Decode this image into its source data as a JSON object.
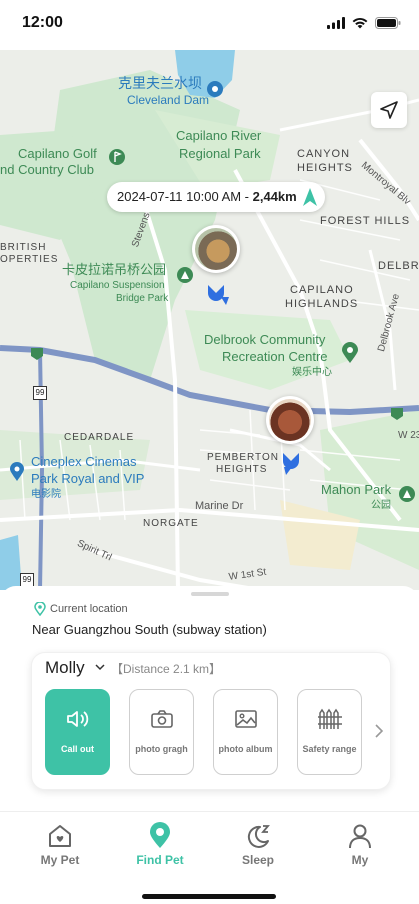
{
  "status_bar": {
    "time": "12:00"
  },
  "map": {
    "labels": {
      "cleveland_cn": "克里夫兰水坝",
      "cleveland_en": "Cleveland Dam",
      "capilano_river": "Capilano River",
      "regional_park": "Regional Park",
      "golf_line1": "Capilano Golf",
      "golf_line2": "nd Country Club",
      "canyon": "CANYON",
      "heights": "HEIGHTS",
      "montroyal": "Montroyal Blv",
      "forest_hills": "FOREST HILLS",
      "stevens": "Stevens",
      "british": "BRITISH",
      "operties": "OPERTIES",
      "suspension_cn": "卡皮拉诺吊桥公园",
      "suspension_en1": "Capilano Suspension",
      "suspension_en2": "Bridge Park",
      "delbr": "DELBR",
      "capilano_h1": "CAPILANO",
      "capilano_h2": "HIGHLANDS",
      "delbrook_ave": "Delbrook Ave",
      "delbrook_cc1": "Delbrook Community",
      "delbrook_cc2": "Recreation Centre",
      "delbrook_cn": "娱乐中心",
      "hwy_99": "99",
      "cedardale": "CEDARDALE",
      "w23": "W 23",
      "cineplex1": "Cineplex Cinemas",
      "cineplex2": "Park Royal and VIP",
      "cineplex_cn": "电影院",
      "pemberton1": "PEMBERTON",
      "pemberton2": "HEIGHTS",
      "mahon": "Mahon Park",
      "mahon_cn": "公园",
      "marine": "Marine Dr",
      "norgate": "NORGATE",
      "spirit": "Spirit Trl",
      "w1st": "W 1st St",
      "hwy_99_b": "99"
    },
    "track": {
      "datetime": "2024-07-11 10:00 AM - ",
      "distance": "2,44km"
    }
  },
  "sheet": {
    "location_label": "Current location",
    "location_value": "Near Guangzhou South (subway station)",
    "pet_name": "Molly",
    "pet_distance": "【Distance 2.1 km】",
    "actions": [
      {
        "label": "Call out"
      },
      {
        "label": "photo gragh"
      },
      {
        "label": "photo album"
      },
      {
        "label": "Safety range"
      }
    ]
  },
  "tabs": [
    {
      "label": "My Pet"
    },
    {
      "label": "Find Pet"
    },
    {
      "label": "Sleep"
    },
    {
      "label": "My"
    }
  ],
  "colors": {
    "accent": "#3ec2a6",
    "park_green": "#cfe8cf",
    "water": "#8fcde8",
    "route_blue": "#7f95c5"
  }
}
